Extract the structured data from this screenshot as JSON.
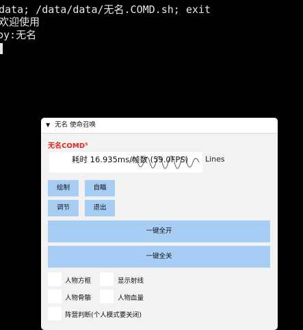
{
  "terminal": {
    "line1": "data; /data/data/无名.COMD.sh; exit",
    "line2": "欢迎使用",
    "line3": "by:无名"
  },
  "panel": {
    "title": "无名 使命召唤",
    "collapse_icon": "triangle-down-icon",
    "brand": "无名COMD⁵",
    "fps_text": "耗时 16.935ms/帧数 (59.0FPS)",
    "lines_label": "Lines",
    "buttons": {
      "draw": "绘制",
      "aim": "自瞄",
      "adjust": "调节",
      "exit": "退出",
      "all_on": "一键全开",
      "all_off": "一键全关"
    },
    "checkboxes": [
      {
        "label": "人物方框",
        "checked": false
      },
      {
        "label": "显示射线",
        "checked": false
      },
      {
        "label": "人物骨骼",
        "checked": false
      },
      {
        "label": "人物血量",
        "checked": false
      },
      {
        "label": "阵营判断(个人模式要关闭)",
        "checked": false
      }
    ],
    "colors": {
      "button": "#a8cdf5",
      "brand": "#e0261f",
      "panel_bg": "#f2f2f2"
    }
  }
}
